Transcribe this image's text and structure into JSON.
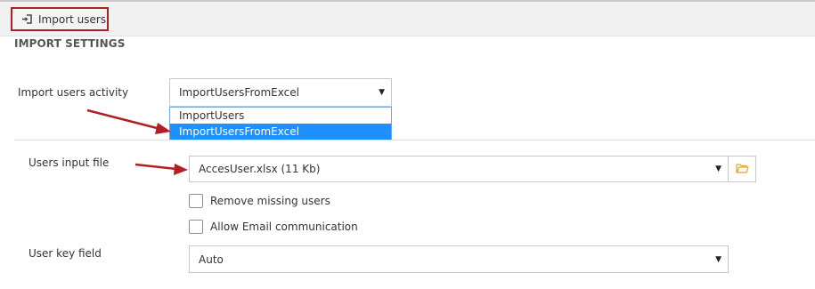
{
  "header": {
    "import_button": {
      "label": "Import users",
      "icon": "sign-in-icon"
    }
  },
  "section": {
    "title": "IMPORT SETTINGS"
  },
  "activity": {
    "label": "Import users activity",
    "selected": "ImportUsersFromExcel",
    "options": [
      "ImportUsers",
      "ImportUsersFromExcel"
    ]
  },
  "input_file": {
    "label": "Users input file",
    "selected": "AccesUser.xlsx (11 Kb)",
    "browse_icon": "folder-open-icon"
  },
  "checkboxes": [
    {
      "label": "Remove missing users",
      "checked": false
    },
    {
      "label": "Allow Email communication",
      "checked": false
    }
  ],
  "key_field": {
    "label": "User key field",
    "selected": "Auto"
  },
  "colors": {
    "highlight_border": "#b01f24",
    "annotation_arrow": "#b01f24",
    "dropdown_selected": "#1e90ff",
    "folder_icon": "#e0a530"
  }
}
